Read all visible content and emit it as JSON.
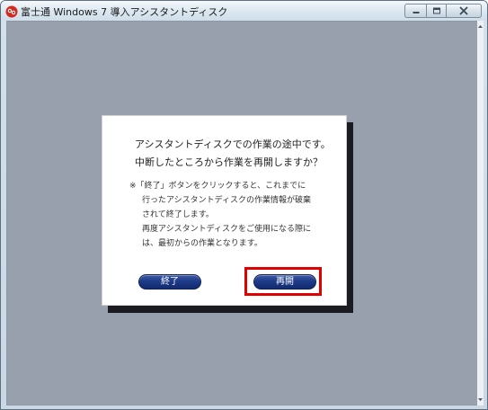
{
  "window": {
    "title": "富士通 Windows 7 導入アシスタントディスク",
    "icons": {
      "app": "fujitsu-app-icon",
      "minimize": "minimize-icon",
      "maximize": "maximize-icon",
      "close": "close-icon"
    }
  },
  "dialog": {
    "message_lines": [
      "アシスタントディスクでの作業の途中です。",
      "中断したところから作業を再開しますか？"
    ],
    "note_lines": [
      "※「終了」ボタンをクリックすると、これまでに",
      "行ったアシスタントディスクの作業情報が破棄",
      "されて終了します。",
      "再度アシスタントディスクをご使用になる際に",
      "は、最初からの作業となります。"
    ],
    "buttons": {
      "end_label": "終了",
      "resume_label": "再開"
    }
  },
  "colors": {
    "client_background": "#99a0ad",
    "button_blue": "#1e3b88",
    "highlight_red": "#e00000"
  }
}
